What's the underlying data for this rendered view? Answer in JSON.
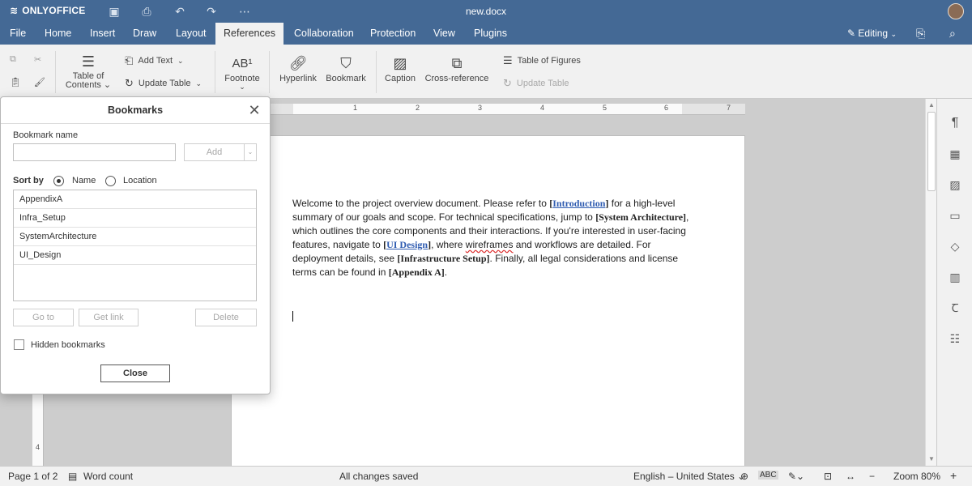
{
  "app": {
    "logo_text": "ONLYOFFICE",
    "doc_title": "new.docx"
  },
  "tabs": [
    "File",
    "Home",
    "Insert",
    "Draw",
    "Layout",
    "References",
    "Collaboration",
    "Protection",
    "View",
    "Plugins"
  ],
  "active_tab": "References",
  "mode": {
    "label": "Editing"
  },
  "toolbar": {
    "toc_label_1": "Table of",
    "toc_label_2": "Contents",
    "add_text": "Add Text",
    "update_table": "Update Table",
    "footnote": "Footnote",
    "hyperlink": "Hyperlink",
    "bookmark": "Bookmark",
    "caption": "Caption",
    "cross_reference": "Cross-reference",
    "table_of_figures": "Table of Figures",
    "update_table_disabled": "Update Table"
  },
  "ruler": {
    "numbers": [
      "1",
      "2",
      "3",
      "4",
      "5",
      "6",
      "7"
    ],
    "v_number": "4"
  },
  "document": {
    "t1": "Welcome to the project overview document. Please refer to ",
    "r1": "[",
    "link1": "Introduction",
    "r1b": "]",
    "t2": " for a high-level summary of our goals and scope. For technical specifications, jump to ",
    "r2": "[System Architecture]",
    "t3": ", which outlines the core components and their interactions. If you're interested in user-facing features, navigate to ",
    "r3": "[",
    "link2": "UI Design",
    "r3b": "]",
    "t4": ", where ",
    "squig": "wireframes",
    "t5": " and workflows are detailed. For deployment details, see ",
    "r4": "[Infrastructure Setup]",
    "t6": ". Finally, all legal considerations and license terms can be found in ",
    "r5": "[Appendix A]",
    "t7": "."
  },
  "dialog": {
    "title": "Bookmarks",
    "name_label": "Bookmark name",
    "name_value": "",
    "add_button": "Add",
    "sort_by": "Sort by",
    "sort_name": "Name",
    "sort_location": "Location",
    "sort_selected": "Name",
    "bookmarks": [
      "AppendixA",
      "Infra_Setup",
      "SystemArchitecture",
      "UI_Design"
    ],
    "go_to": "Go to",
    "get_link": "Get link",
    "delete": "Delete",
    "hidden_bookmarks": "Hidden bookmarks",
    "close": "Close"
  },
  "status": {
    "page": "Page 1 of 2",
    "word_count": "Word count",
    "saved": "All changes saved",
    "language": "English – United States",
    "zoom": "Zoom 80%"
  },
  "colors": {
    "brand": "#446995",
    "link": "#2e5bb0",
    "spell_error": "#dd3333"
  }
}
